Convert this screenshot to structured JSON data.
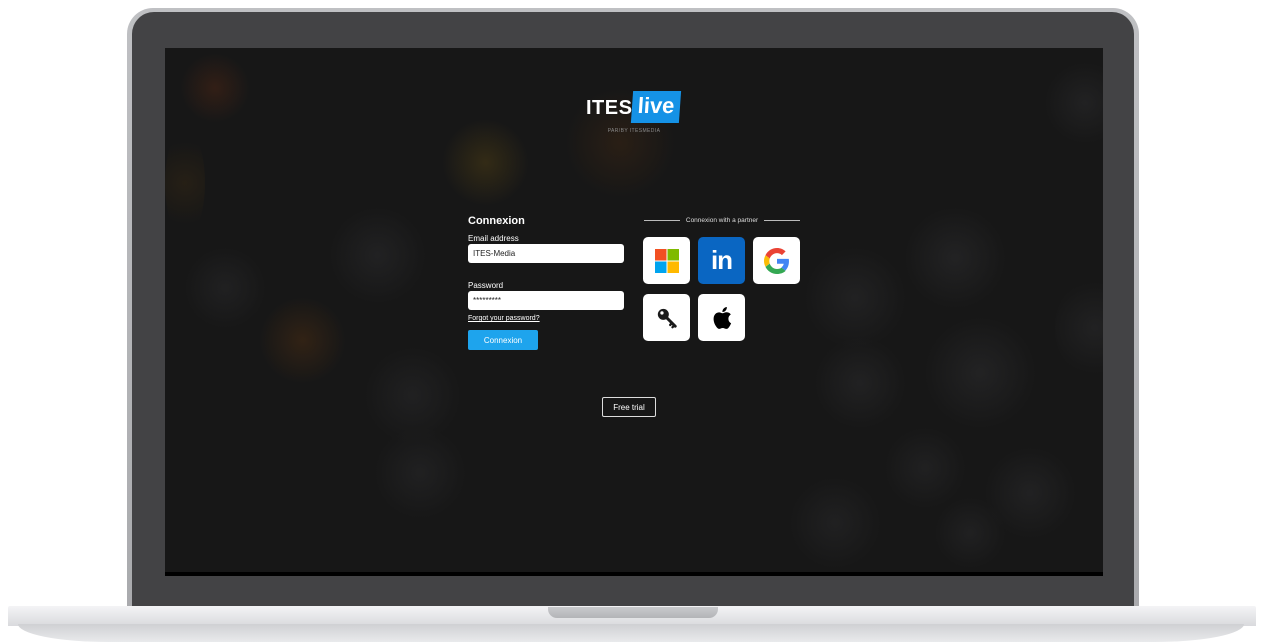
{
  "logo": {
    "brand": "ITES",
    "badge": "live",
    "tagline": "PAR/BY ITESMEDIA"
  },
  "login": {
    "title": "Connexion",
    "email_label": "Email address",
    "email_value": "ITES-Media",
    "password_label": "Password",
    "password_value": "*********",
    "forgot_link": "Forgot your password?",
    "submit_label": "Connexion"
  },
  "partners": {
    "heading": "Connexion with a partner",
    "providers": [
      {
        "name": "microsoft",
        "icon": "microsoft-icon"
      },
      {
        "name": "linkedin",
        "icon": "linkedin-icon",
        "label": "in"
      },
      {
        "name": "google",
        "icon": "google-icon"
      },
      {
        "name": "key",
        "icon": "key-icon"
      },
      {
        "name": "apple",
        "icon": "apple-icon"
      }
    ]
  },
  "free_trial_label": "Free trial",
  "colors": {
    "accent": "#1ea4ed",
    "logo_blue": "#1592e6",
    "linkedin": "#0a66c2",
    "background": "#171717"
  }
}
